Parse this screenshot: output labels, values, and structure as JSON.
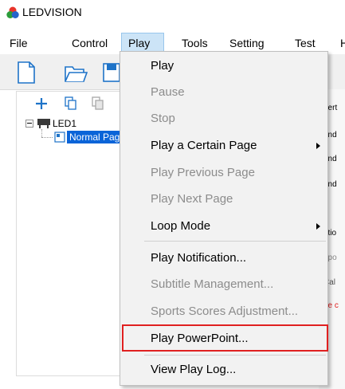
{
  "app": {
    "title": "LEDVISION"
  },
  "menubar": {
    "file": "File",
    "control": "Control",
    "play": "Play",
    "tools": "Tools",
    "setting": "Setting",
    "test": "Test",
    "help": "H"
  },
  "tree": {
    "root": "LED1",
    "child": "Normal Pag"
  },
  "right_panel": {
    "lines": [
      "pert",
      "und",
      "und",
      "und",
      "atio",
      "ppo",
      "Cal",
      "he c"
    ]
  },
  "play_menu": {
    "items": [
      {
        "label": "Play"
      },
      {
        "label": "Pause"
      },
      {
        "label": "Stop"
      },
      {
        "label": "Play a Certain Page"
      },
      {
        "label": "Play Previous Page"
      },
      {
        "label": "Play Next Page"
      },
      {
        "label": "Loop Mode"
      },
      {
        "label": "Play Notification..."
      },
      {
        "label": "Subtitle Management..."
      },
      {
        "label": "Sports Scores Adjustment..."
      },
      {
        "label": "Play PowerPoint..."
      },
      {
        "label": "View Play Log..."
      }
    ]
  },
  "colors": {
    "menu_highlight_bg": "#cce4f7",
    "menu_highlight_border": "#99c6ec",
    "outline_red": "#e02020",
    "tree_selected": "#0a64d8"
  }
}
